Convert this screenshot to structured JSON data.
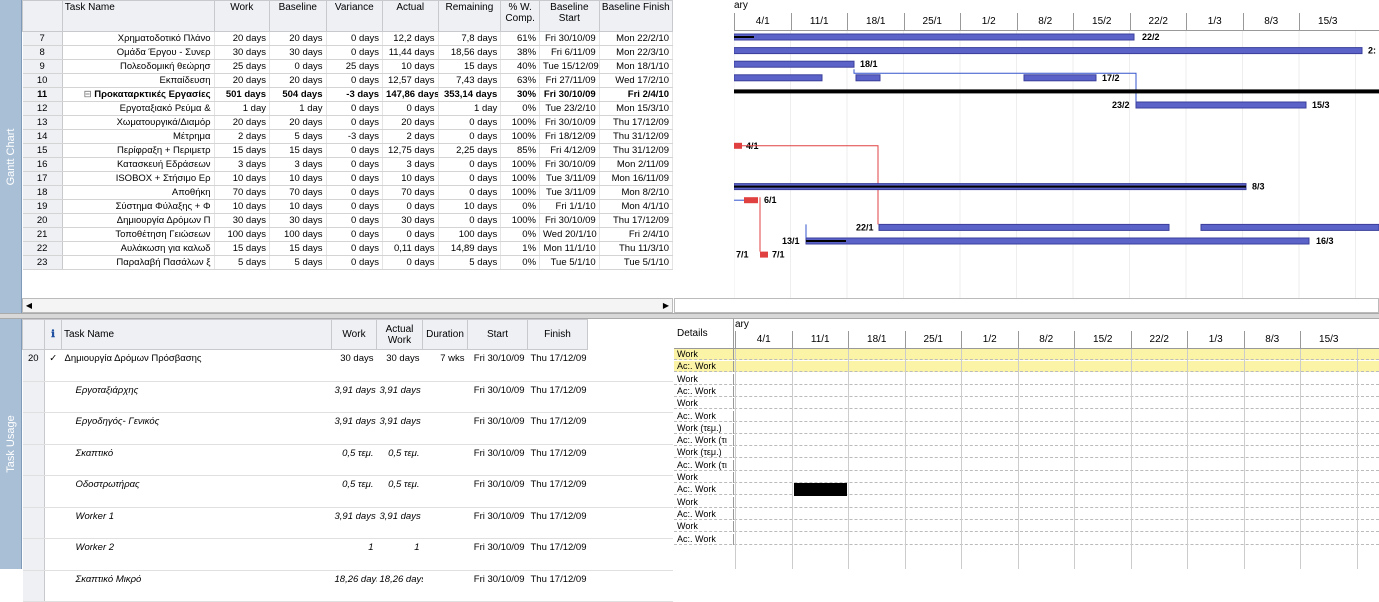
{
  "views": {
    "gantt_label": "Gantt Chart",
    "usage_label": "Task Usage"
  },
  "colors": {
    "bar": "#5b63c9",
    "critical": "#e04040",
    "highlight": "#fbf3a6",
    "summary": "#000000"
  },
  "top_table": {
    "headers": [
      "Task Name",
      "Work",
      "Baseline",
      "Variance",
      "Actual",
      "Remaining",
      "% W. Comp.",
      "Baseline Start",
      "Baseline Finish"
    ],
    "rows": [
      {
        "id": "7",
        "name": "Χρηματοδοτικό Πλάνο",
        "work": "20 days",
        "baseline": "20 days",
        "variance": "0 days",
        "actual": "12,2 days",
        "remaining": "7,8 days",
        "pct": "61%",
        "bstart": "Fri 30/10/09",
        "bfinish": "Mon 22/2/10"
      },
      {
        "id": "8",
        "name": "Ομάδα Έργου - Συνερ",
        "work": "30 days",
        "baseline": "30 days",
        "variance": "0 days",
        "actual": "11,44 days",
        "remaining": "18,56 days",
        "pct": "38%",
        "bstart": "Fri 6/11/09",
        "bfinish": "Mon 22/3/10"
      },
      {
        "id": "9",
        "name": "Πολεοδομική θεώρησ",
        "work": "25 days",
        "baseline": "0 days",
        "variance": "25 days",
        "actual": "10 days",
        "remaining": "15 days",
        "pct": "40%",
        "bstart": "Tue 15/12/09",
        "bfinish": "Mon 18/1/10"
      },
      {
        "id": "10",
        "name": "Εκπαίδευση",
        "work": "20 days",
        "baseline": "20 days",
        "variance": "0 days",
        "actual": "12,57 days",
        "remaining": "7,43 days",
        "pct": "63%",
        "bstart": "Fri 27/11/09",
        "bfinish": "Wed 17/2/10"
      },
      {
        "id": "11",
        "name": "Προκαταρκτικές Εργασίες",
        "work": "501 days",
        "baseline": "504 days",
        "variance": "-3 days",
        "actual": "147,86 days",
        "remaining": "353,14 days",
        "pct": "30%",
        "bstart": "Fri 30/10/09",
        "bfinish": "Fri 2/4/10",
        "summary": true
      },
      {
        "id": "12",
        "name": "Εργοταξιακό Ρεύμα &",
        "work": "1 day",
        "baseline": "1 day",
        "variance": "0 days",
        "actual": "0 days",
        "remaining": "1 day",
        "pct": "0%",
        "bstart": "Tue 23/2/10",
        "bfinish": "Mon 15/3/10"
      },
      {
        "id": "13",
        "name": "Χωματουργικά/Διαμόρ",
        "work": "20 days",
        "baseline": "20 days",
        "variance": "0 days",
        "actual": "20 days",
        "remaining": "0 days",
        "pct": "100%",
        "bstart": "Fri 30/10/09",
        "bfinish": "Thu 17/12/09"
      },
      {
        "id": "14",
        "name": "Μέτρημα",
        "work": "2 days",
        "baseline": "5 days",
        "variance": "-3 days",
        "actual": "2 days",
        "remaining": "0 days",
        "pct": "100%",
        "bstart": "Fri 18/12/09",
        "bfinish": "Thu 31/12/09"
      },
      {
        "id": "15",
        "name": "Περίφραξη + Περιμετρ",
        "work": "15 days",
        "baseline": "15 days",
        "variance": "0 days",
        "actual": "12,75 days",
        "remaining": "2,25 days",
        "pct": "85%",
        "bstart": "Fri 4/12/09",
        "bfinish": "Thu 31/12/09"
      },
      {
        "id": "16",
        "name": "Κατασκευή Εδράσεων",
        "work": "3 days",
        "baseline": "3 days",
        "variance": "0 days",
        "actual": "3 days",
        "remaining": "0 days",
        "pct": "100%",
        "bstart": "Fri 30/10/09",
        "bfinish": "Mon 2/11/09"
      },
      {
        "id": "17",
        "name": "ISOBOX + Στήσιμο Ερ",
        "work": "10 days",
        "baseline": "10 days",
        "variance": "0 days",
        "actual": "10 days",
        "remaining": "0 days",
        "pct": "100%",
        "bstart": "Tue 3/11/09",
        "bfinish": "Mon 16/11/09"
      },
      {
        "id": "18",
        "name": "Αποθήκη",
        "work": "70 days",
        "baseline": "70 days",
        "variance": "0 days",
        "actual": "70 days",
        "remaining": "0 days",
        "pct": "100%",
        "bstart": "Tue 3/11/09",
        "bfinish": "Mon 8/2/10"
      },
      {
        "id": "19",
        "name": "Σύστημα Φύλαξης + Φ",
        "work": "10 days",
        "baseline": "10 days",
        "variance": "0 days",
        "actual": "0 days",
        "remaining": "10 days",
        "pct": "0%",
        "bstart": "Fri 1/1/10",
        "bfinish": "Mon 4/1/10"
      },
      {
        "id": "20",
        "name": "Δημιουργία Δρόμων Π",
        "work": "30 days",
        "baseline": "30 days",
        "variance": "0 days",
        "actual": "30 days",
        "remaining": "0 days",
        "pct": "100%",
        "bstart": "Fri 30/10/09",
        "bfinish": "Thu 17/12/09"
      },
      {
        "id": "21",
        "name": "Τοποθέτηση Γειώσεων",
        "work": "100 days",
        "baseline": "100 days",
        "variance": "0 days",
        "actual": "0 days",
        "remaining": "100 days",
        "pct": "0%",
        "bstart": "Wed 20/1/10",
        "bfinish": "Fri 2/4/10"
      },
      {
        "id": "22",
        "name": "Αυλάκωση για καλωδ",
        "work": "15 days",
        "baseline": "15 days",
        "variance": "0 days",
        "actual": "0,11 days",
        "remaining": "14,89 days",
        "pct": "1%",
        "bstart": "Mon 11/1/10",
        "bfinish": "Thu 11/3/10"
      },
      {
        "id": "23",
        "name": "Παραλαβή Πασάλων ξ",
        "work": "5 days",
        "baseline": "5 days",
        "variance": "0 days",
        "actual": "0 days",
        "remaining": "5 days",
        "pct": "0%",
        "bstart": "Tue 5/1/10",
        "bfinish": "Tue 5/1/10"
      }
    ]
  },
  "timescale": {
    "month_label": "ary",
    "weeks": [
      "4/1",
      "11/1",
      "18/1",
      "25/1",
      "1/2",
      "8/2",
      "15/2",
      "22/2",
      "1/3",
      "8/3",
      "15/3"
    ]
  },
  "gantt_labels": {
    "r7": "22/2",
    "r8": "2:",
    "r9": "18/1",
    "r10": "17/2",
    "r12a": "23/2",
    "r12b": "15/3",
    "r15": "4/1",
    "r18": "8/3",
    "r19": "6/1",
    "r21": "22/1",
    "r22a": "13/1",
    "r22b": "16/3",
    "r23a": "7/1",
    "r23b": "7/1"
  },
  "usage_table": {
    "headers": [
      "Task Name",
      "Work",
      "Actual Work",
      "Duration",
      "Start",
      "Finish"
    ],
    "info_header": "ℹ",
    "rows": [
      {
        "id": "20",
        "check": "✓",
        "name": "Δημιουργία Δρόμων Πρόσβασης",
        "work": "30 days",
        "actual": "30 days",
        "duration": "7 wks",
        "start": "Fri 30/10/09",
        "finish": "Thu 17/12/09",
        "task": true
      },
      {
        "id": "",
        "check": "",
        "name": "Εργοταξιάρχης",
        "work": "3,91 days",
        "actual": "3,91 days",
        "duration": "",
        "start": "Fri 30/10/09",
        "finish": "Thu 17/12/09"
      },
      {
        "id": "",
        "check": "",
        "name": "Εργοδηγός- Γενικός",
        "work": "3,91 days",
        "actual": "3,91 days",
        "duration": "",
        "start": "Fri 30/10/09",
        "finish": "Thu 17/12/09"
      },
      {
        "id": "",
        "check": "",
        "name": "Σκαπτικό",
        "work": "0,5 τεμ.",
        "actual": "0,5 τεμ.",
        "duration": "",
        "start": "Fri 30/10/09",
        "finish": "Thu 17/12/09"
      },
      {
        "id": "",
        "check": "",
        "name": "Οδοστρωτήρας",
        "work": "0,5 τεμ.",
        "actual": "0,5 τεμ.",
        "duration": "",
        "start": "Fri 30/10/09",
        "finish": "Thu 17/12/09"
      },
      {
        "id": "",
        "check": "",
        "name": "Worker 1",
        "work": "3,91 days",
        "actual": "3,91 days",
        "duration": "",
        "start": "Fri 30/10/09",
        "finish": "Thu 17/12/09"
      },
      {
        "id": "",
        "check": "",
        "name": "Worker 2",
        "work": "1",
        "actual": "1",
        "duration": "",
        "start": "Fri 30/10/09",
        "finish": "Thu 17/12/09"
      },
      {
        "id": "",
        "check": "",
        "name": "Σκαπτικό Μικρό",
        "work": "18,26 days",
        "actual": "18,26 days",
        "duration": "",
        "start": "Fri 30/10/09",
        "finish": "Thu 17/12/09"
      }
    ]
  },
  "details": {
    "label": "Details",
    "rows": [
      "Work",
      "Ac:. Work",
      "Work",
      "Ac:. Work",
      "Work",
      "Ac:. Work",
      "Work (τεμ.)",
      "Ac:. Work (τι",
      "Work (τεμ.)",
      "Ac:. Work (τι",
      "Work",
      "Ac:. Work",
      "Work",
      "Ac:. Work",
      "Work",
      "Ac:. Work"
    ]
  }
}
